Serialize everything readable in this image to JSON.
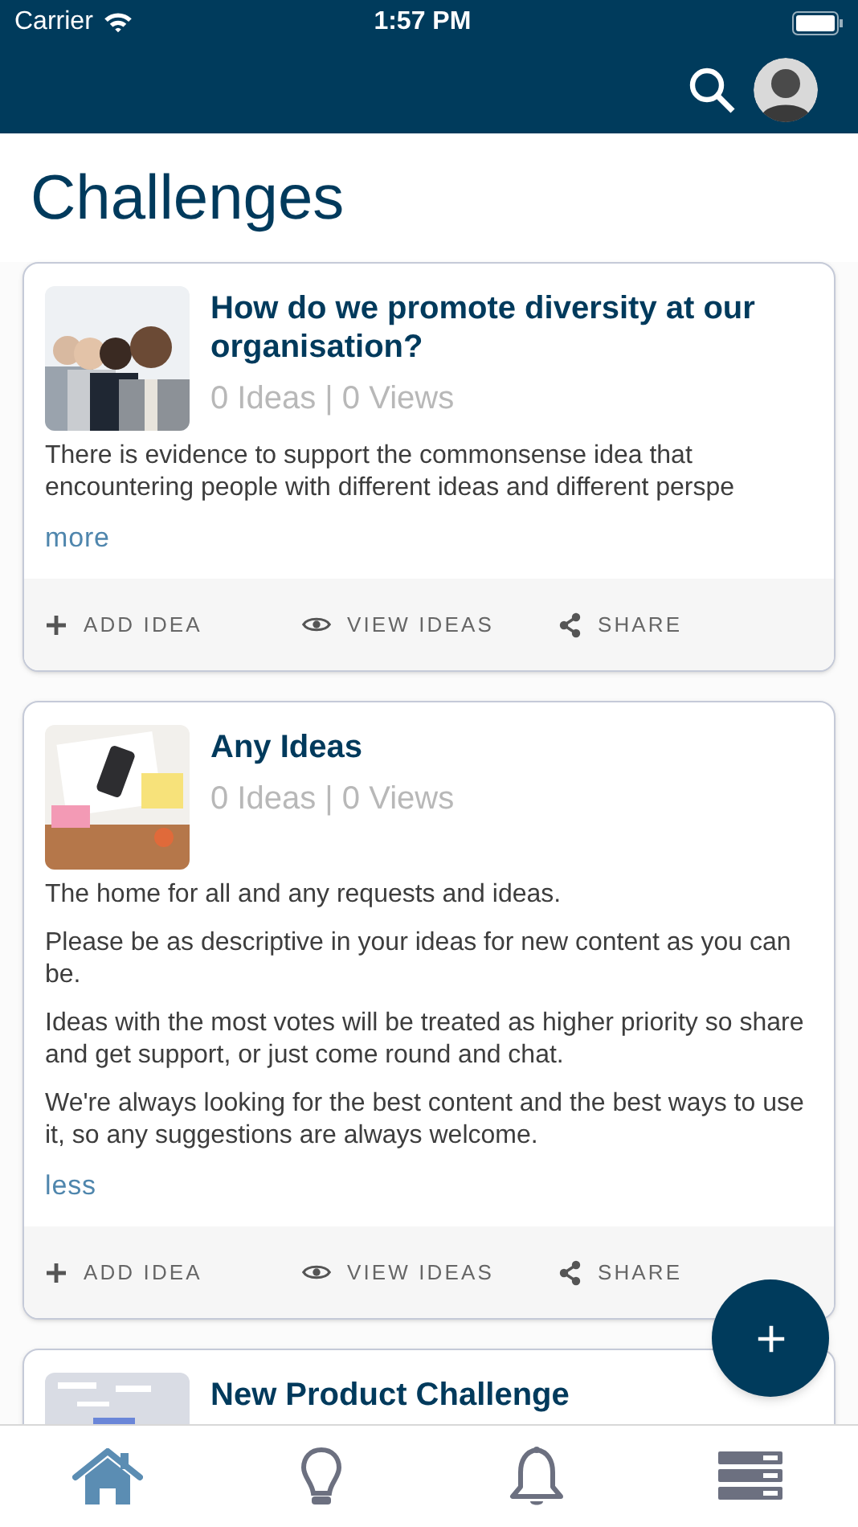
{
  "status_bar": {
    "carrier": "Carrier",
    "time": "1:57 PM"
  },
  "page_title": "Challenges",
  "challenges": [
    {
      "title": "How do we promote diversity at our organisation?",
      "image": {
        "kind": "picture"
      },
      "stats": "0 Ideas | 0 Views",
      "paragraphs": [
        "There is evidence to support the commonsense idea that encountering people with different ideas and different perspe"
      ],
      "toggle": "more",
      "actions": [
        "ADD IDEA",
        "VIEW IDEAS",
        "SHARE"
      ]
    },
    {
      "title": "Any Ideas",
      "image": {
        "kind": "picture"
      },
      "stats": "0 Ideas | 0 Views",
      "paragraphs": [
        "The home for all and any requests and ideas.",
        "Please be as descriptive in your ideas for new content as you can be.",
        "Ideas with the most votes will be treated as higher priority so share and get support, or just come round and chat.",
        "We're always looking for the best content and the best ways to use it, so any suggestions are always welcome."
      ],
      "toggle": "less",
      "actions": [
        "ADD IDEA",
        "VIEW IDEAS",
        "SHARE"
      ]
    },
    {
      "title": "New Product Challenge",
      "image": {
        "kind": "picture"
      }
    }
  ],
  "tabs": [
    {
      "kind": "home",
      "selected": true
    },
    {
      "kind": "ideas",
      "selected": false
    },
    {
      "kind": "notifications",
      "selected": false
    },
    {
      "kind": "menu",
      "selected": false
    }
  ]
}
